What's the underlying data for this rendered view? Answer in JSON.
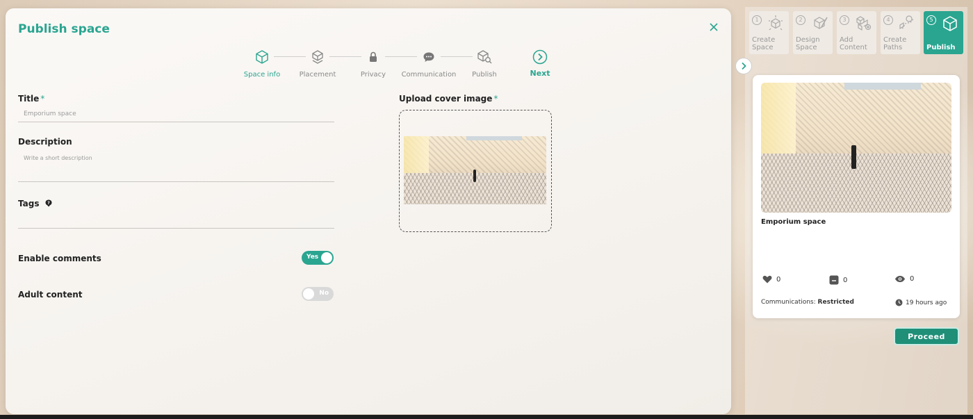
{
  "modal": {
    "title": "Publish space",
    "close_icon": "close-icon",
    "stepper": [
      {
        "label": "Space info",
        "icon": "cube-icon",
        "active": true
      },
      {
        "label": "Placement",
        "icon": "placement-cube-icon",
        "active": false
      },
      {
        "label": "Privacy",
        "icon": "lock-icon",
        "active": false
      },
      {
        "label": "Communication",
        "icon": "chat-icon",
        "active": false
      },
      {
        "label": "Publish",
        "icon": "cube-search-icon",
        "active": false
      }
    ],
    "next_label": "Next",
    "form": {
      "title_label": "Title",
      "title_required": "*",
      "title_value": "Emporium space",
      "description_label": "Description",
      "description_placeholder": "Write a short description",
      "tags_label": "Tags",
      "tags_icon": "help-icon",
      "enable_comments_label": "Enable comments",
      "enable_comments_value": "Yes",
      "adult_content_label": "Adult content",
      "adult_content_value": "No",
      "upload_label": "Upload cover image",
      "upload_required": "*"
    }
  },
  "sidebar": {
    "tabs": [
      {
        "num": "1",
        "label": "Create Space",
        "icon": "create-space-icon",
        "active": false
      },
      {
        "num": "2",
        "label": "Design Space",
        "icon": "design-space-icon",
        "active": false
      },
      {
        "num": "3",
        "label": "Add Content",
        "icon": "add-content-icon",
        "active": false
      },
      {
        "num": "4",
        "label": "Create Paths",
        "icon": "create-paths-icon",
        "active": false
      },
      {
        "num": "5",
        "label": "Publish",
        "icon": "publish-icon",
        "active": true
      }
    ],
    "collapse_icon": "chevron-right-icon",
    "card": {
      "title": "Emporium space",
      "likes": "0",
      "comments": "0",
      "views": "0",
      "communications_label": "Communications:",
      "communications_value": "Restricted",
      "time": "19 hours ago"
    },
    "proceed_label": "Proceed"
  },
  "colors": {
    "accent": "#2aa590",
    "proceed": "#1f8f78"
  }
}
